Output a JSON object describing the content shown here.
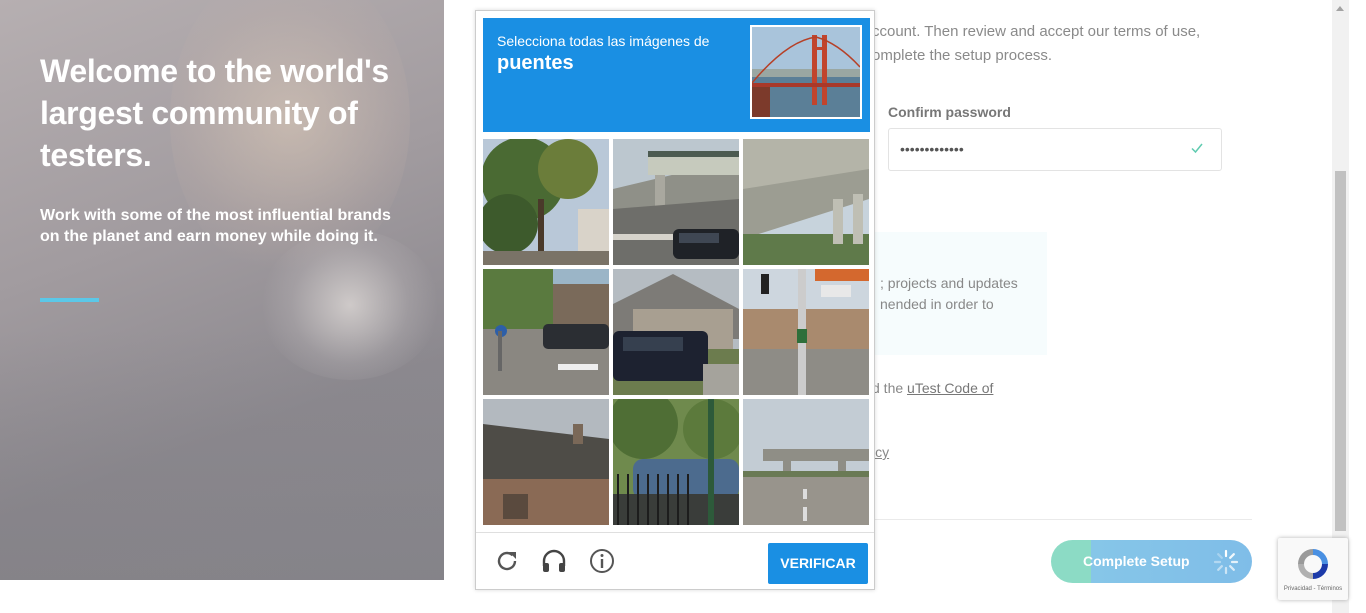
{
  "hero": {
    "title": "Welcome to the world's largest community of testers.",
    "subtitle": "Work with some of the most influential brands on the planet and earn money while doing it."
  },
  "form": {
    "intro_line1": "ccount. Then review and accept our terms of use,",
    "intro_line2": "omplete the setup process.",
    "confirm_password_label": "Confirm password",
    "confirm_password_value": "•••••••••••••",
    "notice_text": "; projects and updates nended in order to",
    "code_prefix": "d the ",
    "code_link": "uTest Code of",
    "policy_link": "icy",
    "complete_button": "Complete Setup"
  },
  "captcha": {
    "instruction": "Selecciona todas las imágenes de",
    "target": "puentes",
    "verify_button": "VERIFICAR",
    "footer_icons": [
      "reload-icon",
      "headphones-icon",
      "info-icon"
    ],
    "tiles": [
      {
        "scene": "tree-house"
      },
      {
        "scene": "overpass-car"
      },
      {
        "scene": "under-bridge"
      },
      {
        "scene": "street-corner"
      },
      {
        "scene": "suv-house"
      },
      {
        "scene": "traffic-pole"
      },
      {
        "scene": "roof-house"
      },
      {
        "scene": "fence-car"
      },
      {
        "scene": "overpass-road"
      }
    ]
  },
  "recaptcha_badge": {
    "links": "Privacidad - Términos"
  },
  "colors": {
    "captcha_blue": "#1a8fe3",
    "accent_teal": "#5bc8e8",
    "button_green": "#8cdbc5"
  }
}
